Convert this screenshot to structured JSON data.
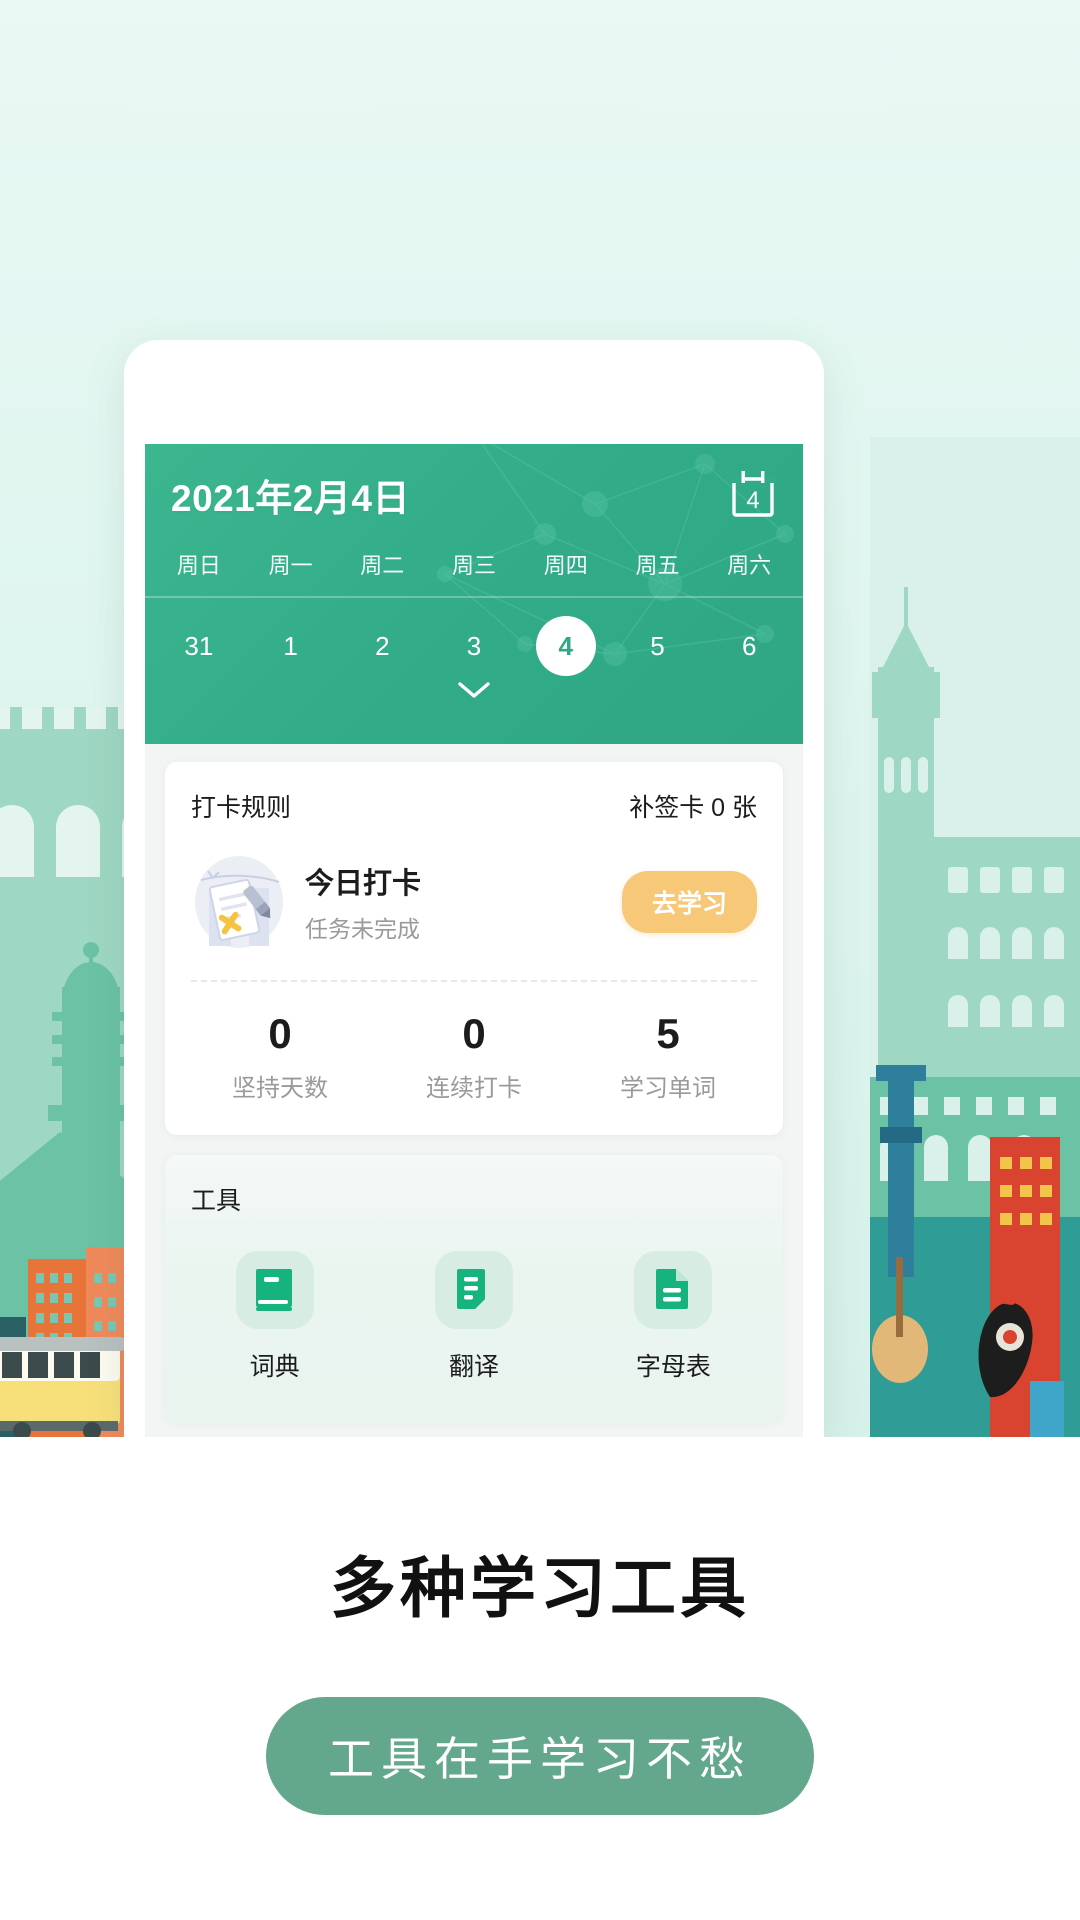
{
  "header": {
    "date_title": "2021年2月4日",
    "calendar_icon": "calendar-icon",
    "calendar_icon_day": "4",
    "weekdays": [
      "周日",
      "周一",
      "周二",
      "周三",
      "周四",
      "周五",
      "周六"
    ],
    "days": [
      "31",
      "1",
      "2",
      "3",
      "4",
      "5",
      "6"
    ],
    "active_day": "4",
    "expand_icon": "chevron-down-icon",
    "accent_color": "#31ab88"
  },
  "checkin_card": {
    "rule_label": "打卡规则",
    "makeup_card_label": "补签卡 0 张",
    "title": "今日打卡",
    "subtitle": "任务未完成",
    "button_label": "去学习",
    "button_color": "#f6c878",
    "illustration": "checklist-illustration",
    "stats": [
      {
        "value": "0",
        "caption": "坚持天数"
      },
      {
        "value": "0",
        "caption": "连续打卡"
      },
      {
        "value": "5",
        "caption": "学习单词"
      }
    ]
  },
  "tools_card": {
    "title": "工具",
    "items": [
      {
        "label": "词典",
        "icon": "book-icon"
      },
      {
        "label": "翻译",
        "icon": "translate-document-icon"
      },
      {
        "label": "字母表",
        "icon": "file-text-icon"
      }
    ]
  },
  "promo": {
    "heading": "多种学习工具",
    "pill_label": "工具在手学习不愁",
    "pill_color": "#63a88d"
  }
}
